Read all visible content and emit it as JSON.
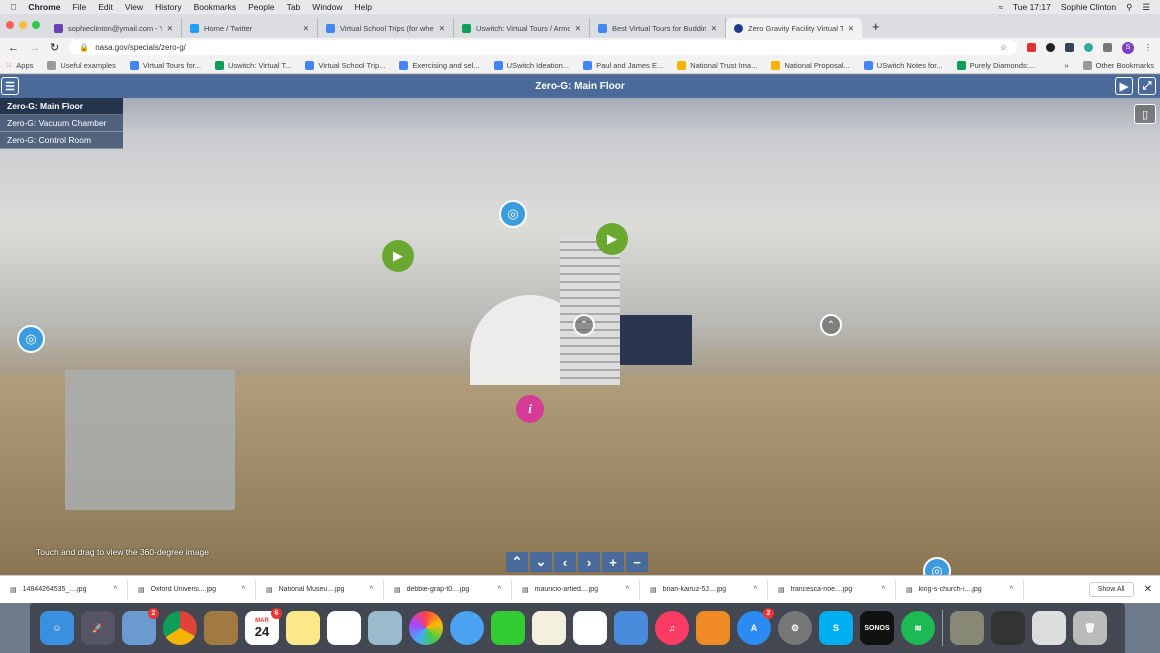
{
  "menubar": {
    "app": "Chrome",
    "items": [
      "File",
      "Edit",
      "View",
      "History",
      "Bookmarks",
      "People",
      "Tab",
      "Window",
      "Help"
    ],
    "clock": "Tue 17:17",
    "user": "Sophie Clinton"
  },
  "tabs": [
    {
      "title": "sophieclinton@ymail.com - Yahoo",
      "color": "#6b3fb5"
    },
    {
      "title": "Home / Twitter",
      "color": "#1da1f2"
    },
    {
      "title": "Virtual School Trips (for when ...",
      "color": "#4285f4"
    },
    {
      "title": "Uswitch: Virtual Tours / Armch...",
      "color": "#0f9d58"
    },
    {
      "title": "Best Virtual Tours for Budding",
      "color": "#4285f4"
    },
    {
      "title": "Zero Gravity Facility Virtual To...",
      "color": "#1b3c8c",
      "active": true
    }
  ],
  "address": {
    "url": "nasa.gov/specials/zero-g/",
    "profile_initial": "S"
  },
  "bookmarks": [
    "Apps",
    "Useful examples",
    "Virtual Tours for...",
    "Uswitch: Virtual T...",
    "Virtual School Trip...",
    "Exercising and sel...",
    "USwitch Ideation...",
    "Paul and James E...",
    "National Trust Ima...",
    "National Proposal...",
    "USwitch Notes for...",
    "Purely Diamonds:..."
  ],
  "bookmarks_other": "Other Bookmarks",
  "tour": {
    "title": "Zero-G: Main Floor",
    "scenes": [
      "Zero-G: Main Floor",
      "Zero-G: Vacuum Chamber",
      "Zero-G: Control Room"
    ],
    "hint": "Touch and drag to view the 360-degree image",
    "accent": "#4a6b99"
  },
  "downloads": [
    "14844264535_....jpg",
    "Oxford Universi....jpg",
    "National Museu....jpg",
    "debbie-grap-t0....jpg",
    "mauricio-artied....jpg",
    "brian-kairuz-5J....jpg",
    "francesca-noe....jpg",
    "king-s-church-i....jpg"
  ],
  "show_all": "Show All",
  "dock": {
    "calendar_month": "MAR",
    "calendar_day": "24",
    "sonos": "SONOS",
    "badge_a": "2",
    "badge_b": "6",
    "badge_c": "2"
  }
}
